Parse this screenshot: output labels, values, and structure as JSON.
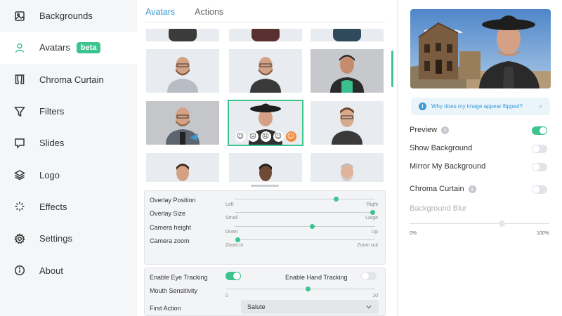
{
  "sidebar": {
    "items": [
      {
        "label": "Backgrounds",
        "icon": "image-icon"
      },
      {
        "label": "Avatars",
        "icon": "person-icon",
        "badge": "beta"
      },
      {
        "label": "Chroma Curtain",
        "icon": "curtain-icon"
      },
      {
        "label": "Filters",
        "icon": "filter-icon"
      },
      {
        "label": "Slides",
        "icon": "slides-icon"
      },
      {
        "label": "Logo",
        "icon": "layers-icon"
      },
      {
        "label": "Effects",
        "icon": "sparkle-icon"
      },
      {
        "label": "Settings",
        "icon": "gear-icon"
      },
      {
        "label": "About",
        "icon": "info-icon"
      }
    ]
  },
  "tabs": {
    "avatars": "Avatars",
    "actions": "Actions"
  },
  "colors": {
    "accent": "#3cc48e",
    "link": "#3c9bd4",
    "expression_active": "#f08a3c"
  },
  "expressions": [
    "☺",
    "☹",
    "☹",
    "☺",
    "☺"
  ],
  "controls": {
    "overlay_position": {
      "label": "Overlay Position",
      "min_label": "Left",
      "max_label": "Right",
      "value": 0.72
    },
    "overlay_size": {
      "label": "Overlay Size",
      "min_label": "Small",
      "max_label": "Large",
      "value": 0.98
    },
    "camera_height": {
      "label": "Camera height",
      "min_label": "Down",
      "max_label": "Up",
      "value": 0.55
    },
    "camera_zoom": {
      "label": "Camera zoom",
      "min_label": "Zoom in",
      "max_label": "Zoom out",
      "value": 0.02
    },
    "eye_tracking": {
      "label": "Enable Eye Tracking",
      "on": true
    },
    "hand_tracking": {
      "label": "Enable Hand Tracking",
      "on": false
    },
    "mouth_sensitivity": {
      "label": "Mouth Sensitivity",
      "min_label": "0",
      "max_label": "10",
      "value": 0.55
    },
    "first_action": {
      "label": "First Action",
      "value": "Salute"
    }
  },
  "right": {
    "hint": "Why does my image appear flipped?",
    "hint_close": "×",
    "info_glyph": "i",
    "preview": {
      "label": "Preview",
      "on": true
    },
    "show_background": {
      "label": "Show Background",
      "on": false
    },
    "mirror_background": {
      "label": "Mirror My Background",
      "on": false
    },
    "chroma_curtain": {
      "label": "Chroma Curtain",
      "on": false
    },
    "blur": {
      "label": "Background Blur",
      "min_label": "0%",
      "max_label": "100%",
      "value": 0.66
    }
  }
}
